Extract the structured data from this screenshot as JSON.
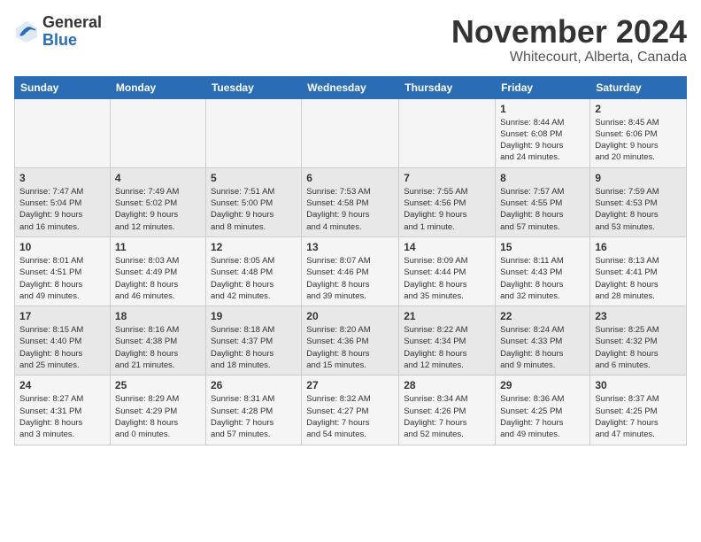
{
  "logo": {
    "general": "General",
    "blue": "Blue",
    "icon_color": "#2a6db5"
  },
  "title": "November 2024",
  "location": "Whitecourt, Alberta, Canada",
  "days_of_week": [
    "Sunday",
    "Monday",
    "Tuesday",
    "Wednesday",
    "Thursday",
    "Friday",
    "Saturday"
  ],
  "weeks": [
    [
      {
        "day": "",
        "info": ""
      },
      {
        "day": "",
        "info": ""
      },
      {
        "day": "",
        "info": ""
      },
      {
        "day": "",
        "info": ""
      },
      {
        "day": "",
        "info": ""
      },
      {
        "day": "1",
        "info": "Sunrise: 8:44 AM\nSunset: 6:08 PM\nDaylight: 9 hours\nand 24 minutes."
      },
      {
        "day": "2",
        "info": "Sunrise: 8:45 AM\nSunset: 6:06 PM\nDaylight: 9 hours\nand 20 minutes."
      }
    ],
    [
      {
        "day": "3",
        "info": "Sunrise: 7:47 AM\nSunset: 5:04 PM\nDaylight: 9 hours\nand 16 minutes."
      },
      {
        "day": "4",
        "info": "Sunrise: 7:49 AM\nSunset: 5:02 PM\nDaylight: 9 hours\nand 12 minutes."
      },
      {
        "day": "5",
        "info": "Sunrise: 7:51 AM\nSunset: 5:00 PM\nDaylight: 9 hours\nand 8 minutes."
      },
      {
        "day": "6",
        "info": "Sunrise: 7:53 AM\nSunset: 4:58 PM\nDaylight: 9 hours\nand 4 minutes."
      },
      {
        "day": "7",
        "info": "Sunrise: 7:55 AM\nSunset: 4:56 PM\nDaylight: 9 hours\nand 1 minute."
      },
      {
        "day": "8",
        "info": "Sunrise: 7:57 AM\nSunset: 4:55 PM\nDaylight: 8 hours\nand 57 minutes."
      },
      {
        "day": "9",
        "info": "Sunrise: 7:59 AM\nSunset: 4:53 PM\nDaylight: 8 hours\nand 53 minutes."
      }
    ],
    [
      {
        "day": "10",
        "info": "Sunrise: 8:01 AM\nSunset: 4:51 PM\nDaylight: 8 hours\nand 49 minutes."
      },
      {
        "day": "11",
        "info": "Sunrise: 8:03 AM\nSunset: 4:49 PM\nDaylight: 8 hours\nand 46 minutes."
      },
      {
        "day": "12",
        "info": "Sunrise: 8:05 AM\nSunset: 4:48 PM\nDaylight: 8 hours\nand 42 minutes."
      },
      {
        "day": "13",
        "info": "Sunrise: 8:07 AM\nSunset: 4:46 PM\nDaylight: 8 hours\nand 39 minutes."
      },
      {
        "day": "14",
        "info": "Sunrise: 8:09 AM\nSunset: 4:44 PM\nDaylight: 8 hours\nand 35 minutes."
      },
      {
        "day": "15",
        "info": "Sunrise: 8:11 AM\nSunset: 4:43 PM\nDaylight: 8 hours\nand 32 minutes."
      },
      {
        "day": "16",
        "info": "Sunrise: 8:13 AM\nSunset: 4:41 PM\nDaylight: 8 hours\nand 28 minutes."
      }
    ],
    [
      {
        "day": "17",
        "info": "Sunrise: 8:15 AM\nSunset: 4:40 PM\nDaylight: 8 hours\nand 25 minutes."
      },
      {
        "day": "18",
        "info": "Sunrise: 8:16 AM\nSunset: 4:38 PM\nDaylight: 8 hours\nand 21 minutes."
      },
      {
        "day": "19",
        "info": "Sunrise: 8:18 AM\nSunset: 4:37 PM\nDaylight: 8 hours\nand 18 minutes."
      },
      {
        "day": "20",
        "info": "Sunrise: 8:20 AM\nSunset: 4:36 PM\nDaylight: 8 hours\nand 15 minutes."
      },
      {
        "day": "21",
        "info": "Sunrise: 8:22 AM\nSunset: 4:34 PM\nDaylight: 8 hours\nand 12 minutes."
      },
      {
        "day": "22",
        "info": "Sunrise: 8:24 AM\nSunset: 4:33 PM\nDaylight: 8 hours\nand 9 minutes."
      },
      {
        "day": "23",
        "info": "Sunrise: 8:25 AM\nSunset: 4:32 PM\nDaylight: 8 hours\nand 6 minutes."
      }
    ],
    [
      {
        "day": "24",
        "info": "Sunrise: 8:27 AM\nSunset: 4:31 PM\nDaylight: 8 hours\nand 3 minutes."
      },
      {
        "day": "25",
        "info": "Sunrise: 8:29 AM\nSunset: 4:29 PM\nDaylight: 8 hours\nand 0 minutes."
      },
      {
        "day": "26",
        "info": "Sunrise: 8:31 AM\nSunset: 4:28 PM\nDaylight: 7 hours\nand 57 minutes."
      },
      {
        "day": "27",
        "info": "Sunrise: 8:32 AM\nSunset: 4:27 PM\nDaylight: 7 hours\nand 54 minutes."
      },
      {
        "day": "28",
        "info": "Sunrise: 8:34 AM\nSunset: 4:26 PM\nDaylight: 7 hours\nand 52 minutes."
      },
      {
        "day": "29",
        "info": "Sunrise: 8:36 AM\nSunset: 4:25 PM\nDaylight: 7 hours\nand 49 minutes."
      },
      {
        "day": "30",
        "info": "Sunrise: 8:37 AM\nSunset: 4:25 PM\nDaylight: 7 hours\nand 47 minutes."
      }
    ]
  ]
}
